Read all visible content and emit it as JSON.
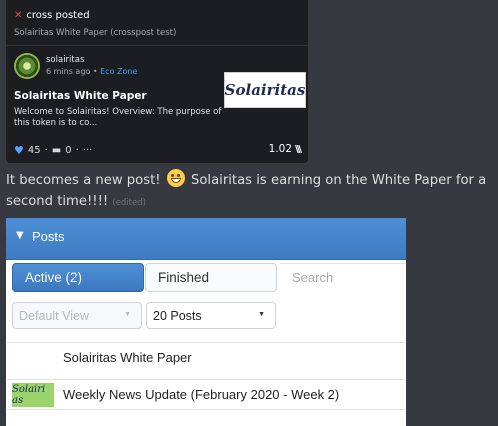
{
  "crosspost": {
    "icon": "crosspost-icon",
    "label": "cross posted",
    "subtitle": "Solairitas White Paper (crosspost test)",
    "author": "solairitas",
    "time": "6 mins ago",
    "separator": "•",
    "community": "Eco Zone",
    "title": "Solairitas White Paper",
    "excerpt": "Welcome to Solairitas! Overview: The purpose of this token is to co...",
    "thumbnail_text": "Solairitas",
    "likes": "45",
    "comments": "0",
    "more": "···",
    "dot": "·",
    "payout": "1.02",
    "payout_icon": "coin-icon",
    "accent_color": "#4aa3ff",
    "cross_color": "#e5484d"
  },
  "message": {
    "text_before": "It becomes a new post!",
    "emoji": "grinning-face-emoji",
    "text_after": "Solairitas is earning on the White Paper for a second time!!!!",
    "edited": "(edited)"
  },
  "posts_panel": {
    "header_title": "Posts",
    "tabs": [
      {
        "label": "Active (2)",
        "active": true
      },
      {
        "label": "Finished",
        "active": false
      }
    ],
    "search_placeholder": "Search",
    "view_select": "Default View",
    "count_select": "20 Posts",
    "rows": [
      {
        "title": "Solairitas White Paper",
        "has_thumb": false
      },
      {
        "title": "Weekly News Update (February 2020 - Week 2)",
        "has_thumb": true,
        "thumb_text": "Solairi as"
      }
    ],
    "header_color": "#4a8ad1"
  }
}
